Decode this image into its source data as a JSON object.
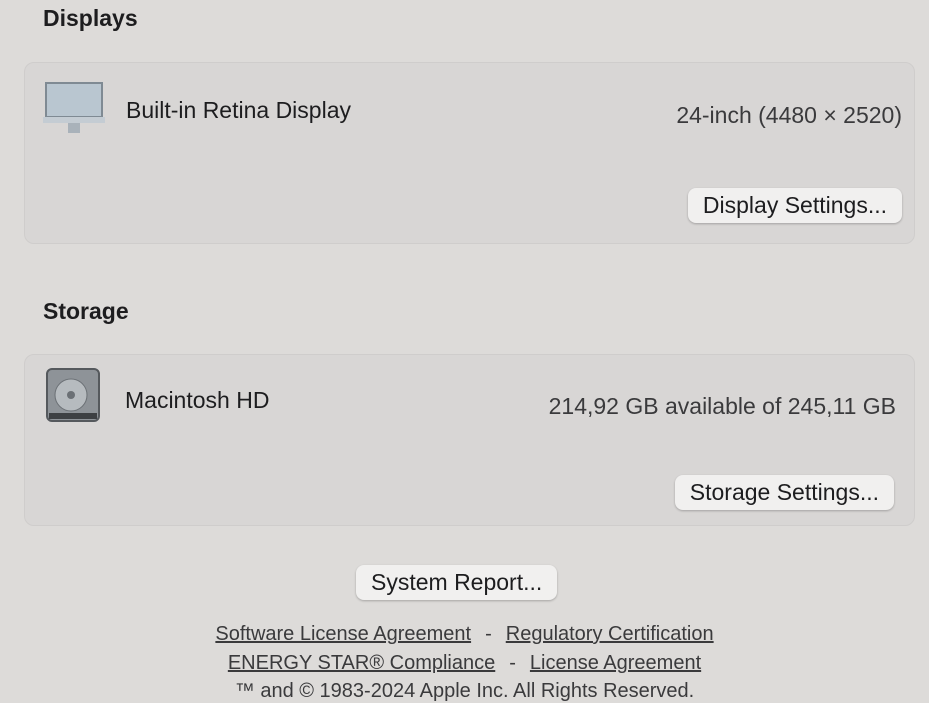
{
  "displays": {
    "heading": "Displays",
    "name": "Built-in Retina Display",
    "spec": "24-inch (4480 × 2520)",
    "settings_button": "Display Settings..."
  },
  "storage": {
    "heading": "Storage",
    "name": "Macintosh HD",
    "spec": "214,92 GB available of 245,11 GB",
    "settings_button": "Storage Settings..."
  },
  "system_report_button": "System Report...",
  "footer": {
    "links_row1": [
      "Software License Agreement",
      "Regulatory Certification"
    ],
    "links_row2": [
      "ENERGY STAR® Compliance",
      "License Agreement"
    ],
    "separator": "-",
    "copyright": "™ and © 1983-2024 Apple Inc. All Rights Reserved."
  }
}
